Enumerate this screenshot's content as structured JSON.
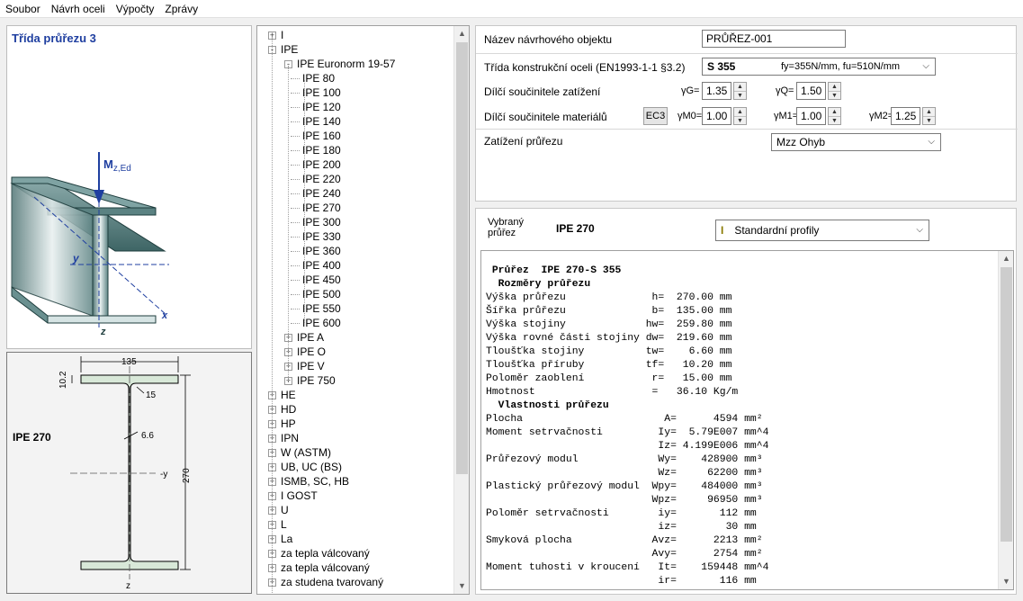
{
  "menu": [
    "Soubor",
    "Návrh oceli",
    "Výpočty",
    "Zprávy"
  ],
  "left": {
    "title": "Třída průřezu 3",
    "moment_label_main": "M",
    "moment_label_sub": "z,Ed",
    "axis_y": "y",
    "axis_x": "x",
    "axis_z": "z"
  },
  "section_drawing": {
    "name": "IPE 270",
    "width_label": "135",
    "flange_label": "10.2",
    "radius_label": "15",
    "web_label": "6.6",
    "height_label": "270",
    "axis_y": "-y",
    "axis_z": "z"
  },
  "tree": {
    "items": [
      {
        "label": "I",
        "level": 0,
        "box": "+"
      },
      {
        "label": "IPE",
        "level": 0,
        "box": "-"
      },
      {
        "label": "IPE  Euronorm 19-57",
        "level": 1,
        "box": "-"
      },
      {
        "label": "IPE 80",
        "level": 2
      },
      {
        "label": "IPE 100",
        "level": 2
      },
      {
        "label": "IPE 120",
        "level": 2
      },
      {
        "label": "IPE 140",
        "level": 2
      },
      {
        "label": "IPE 160",
        "level": 2
      },
      {
        "label": "IPE 180",
        "level": 2
      },
      {
        "label": "IPE 200",
        "level": 2
      },
      {
        "label": "IPE 220",
        "level": 2
      },
      {
        "label": "IPE 240",
        "level": 2
      },
      {
        "label": "IPE 270",
        "level": 2
      },
      {
        "label": "IPE 300",
        "level": 2
      },
      {
        "label": "IPE 330",
        "level": 2
      },
      {
        "label": "IPE 360",
        "level": 2
      },
      {
        "label": "IPE 400",
        "level": 2
      },
      {
        "label": "IPE 450",
        "level": 2
      },
      {
        "label": "IPE 500",
        "level": 2
      },
      {
        "label": "IPE 550",
        "level": 2
      },
      {
        "label": "IPE 600",
        "level": 2
      },
      {
        "label": "IPE A",
        "level": 1,
        "box": "+"
      },
      {
        "label": "IPE O",
        "level": 1,
        "box": "+"
      },
      {
        "label": "IPE V",
        "level": 1,
        "box": "+"
      },
      {
        "label": "IPE 750",
        "level": 1,
        "box": "+"
      },
      {
        "label": "HE",
        "level": 0,
        "box": "+"
      },
      {
        "label": "HD",
        "level": 0,
        "box": "+"
      },
      {
        "label": "HP",
        "level": 0,
        "box": "+"
      },
      {
        "label": "IPN",
        "level": 0,
        "box": "+"
      },
      {
        "label": "W (ASTM)",
        "level": 0,
        "box": "+"
      },
      {
        "label": "UB, UC (BS)",
        "level": 0,
        "box": "+"
      },
      {
        "label": "ISMB, SC, HB",
        "level": 0,
        "box": "+"
      },
      {
        "label": "I GOST",
        "level": 0,
        "box": "+"
      },
      {
        "label": "U",
        "level": 0,
        "box": "+"
      },
      {
        "label": "L",
        "level": 0,
        "box": "+"
      },
      {
        "label": "La",
        "level": 0,
        "box": "+"
      },
      {
        "label": "za tepla válcovaný",
        "level": 0,
        "box": "+"
      },
      {
        "label": "za tepla válcovaný",
        "level": 0,
        "box": "+"
      },
      {
        "label": "za studena tvarovaný",
        "level": 0,
        "box": "+"
      }
    ]
  },
  "props": {
    "name_label": "Název návrhového objektu",
    "name_value": "PRŮŘEZ-001",
    "steel_label": "Třída konstrukční oceli (EN1993-1-1 §3.2)",
    "steel_grade": "S 355",
    "steel_props": "fy=355N/mm, fu=510N/mm",
    "load_factors_label": "Dílčí součinitele zatížení",
    "gammaG_label": "γG=",
    "gammaG_value": "1.35",
    "gammaQ_label": "γQ=",
    "gammaQ_value": "1.50",
    "material_factors_label": "Dílčí součinitele materiálů",
    "ec3_button": "EC3",
    "gammaM0_label": "γM0=",
    "gammaM0_value": "1.00",
    "gammaM1_label": "γM1=",
    "gammaM1_value": "1.00",
    "gammaM2_label": "γM2=",
    "gammaM2_value": "1.25",
    "load_label": "Zatížení průřezu",
    "load_value": "Mzz Ohyb"
  },
  "selection": {
    "label_line1": "Vybraný",
    "label_line2": "průřez",
    "value": "IPE 270",
    "profiles_dropdown": "Standardní profily"
  },
  "output_lines": [
    {
      "text": "",
      "bold": false
    },
    {
      "text": " Průřez  IPE 270-S 355",
      "bold": true
    },
    {
      "text": "  Rozměry průřezu",
      "bold": true
    },
    {
      "text": "Výška průřezu              h=  270.00 mm",
      "bold": false
    },
    {
      "text": "Šířka průřezu              b=  135.00 mm",
      "bold": false
    },
    {
      "text": "Výška stojiny             hw=  259.80 mm",
      "bold": false
    },
    {
      "text": "Výška rovné části stojiny dw=  219.60 mm",
      "bold": false
    },
    {
      "text": "Tloušťka stojiny          tw=    6.60 mm",
      "bold": false
    },
    {
      "text": "Tloušťka příruby          tf=   10.20 mm",
      "bold": false
    },
    {
      "text": "Poloměr zaoblení           r=   15.00 mm",
      "bold": false
    },
    {
      "text": "Hmotnost                   =   36.10 Kg/m",
      "bold": false
    },
    {
      "text": "  Vlastnosti průřezu",
      "bold": true
    },
    {
      "text": "Plocha                       A=      4594 mm²",
      "bold": false
    },
    {
      "text": "Moment setrvačnosti         Iy=  5.79E007 mm^4",
      "bold": false
    },
    {
      "text": "                            Iz= 4.199E006 mm^4",
      "bold": false
    },
    {
      "text": "Průřezový modul             Wy=    428900 mm³",
      "bold": false
    },
    {
      "text": "                            Wz=     62200 mm³",
      "bold": false
    },
    {
      "text": "Plastický průřezový modul  Wpy=    484000 mm³",
      "bold": false
    },
    {
      "text": "                           Wpz=     96950 mm³",
      "bold": false
    },
    {
      "text": "Poloměr setrvačnosti        iy=       112 mm",
      "bold": false
    },
    {
      "text": "                            iz=        30 mm",
      "bold": false
    },
    {
      "text": "Smyková plocha             Avz=      2213 mm²",
      "bold": false
    },
    {
      "text": "                           Avy=      2754 mm²",
      "bold": false
    },
    {
      "text": "Moment tuhosti v kroucení   It=    159448 mm^4",
      "bold": false
    },
    {
      "text": "                            ir=       116 mm",
      "bold": false
    }
  ]
}
